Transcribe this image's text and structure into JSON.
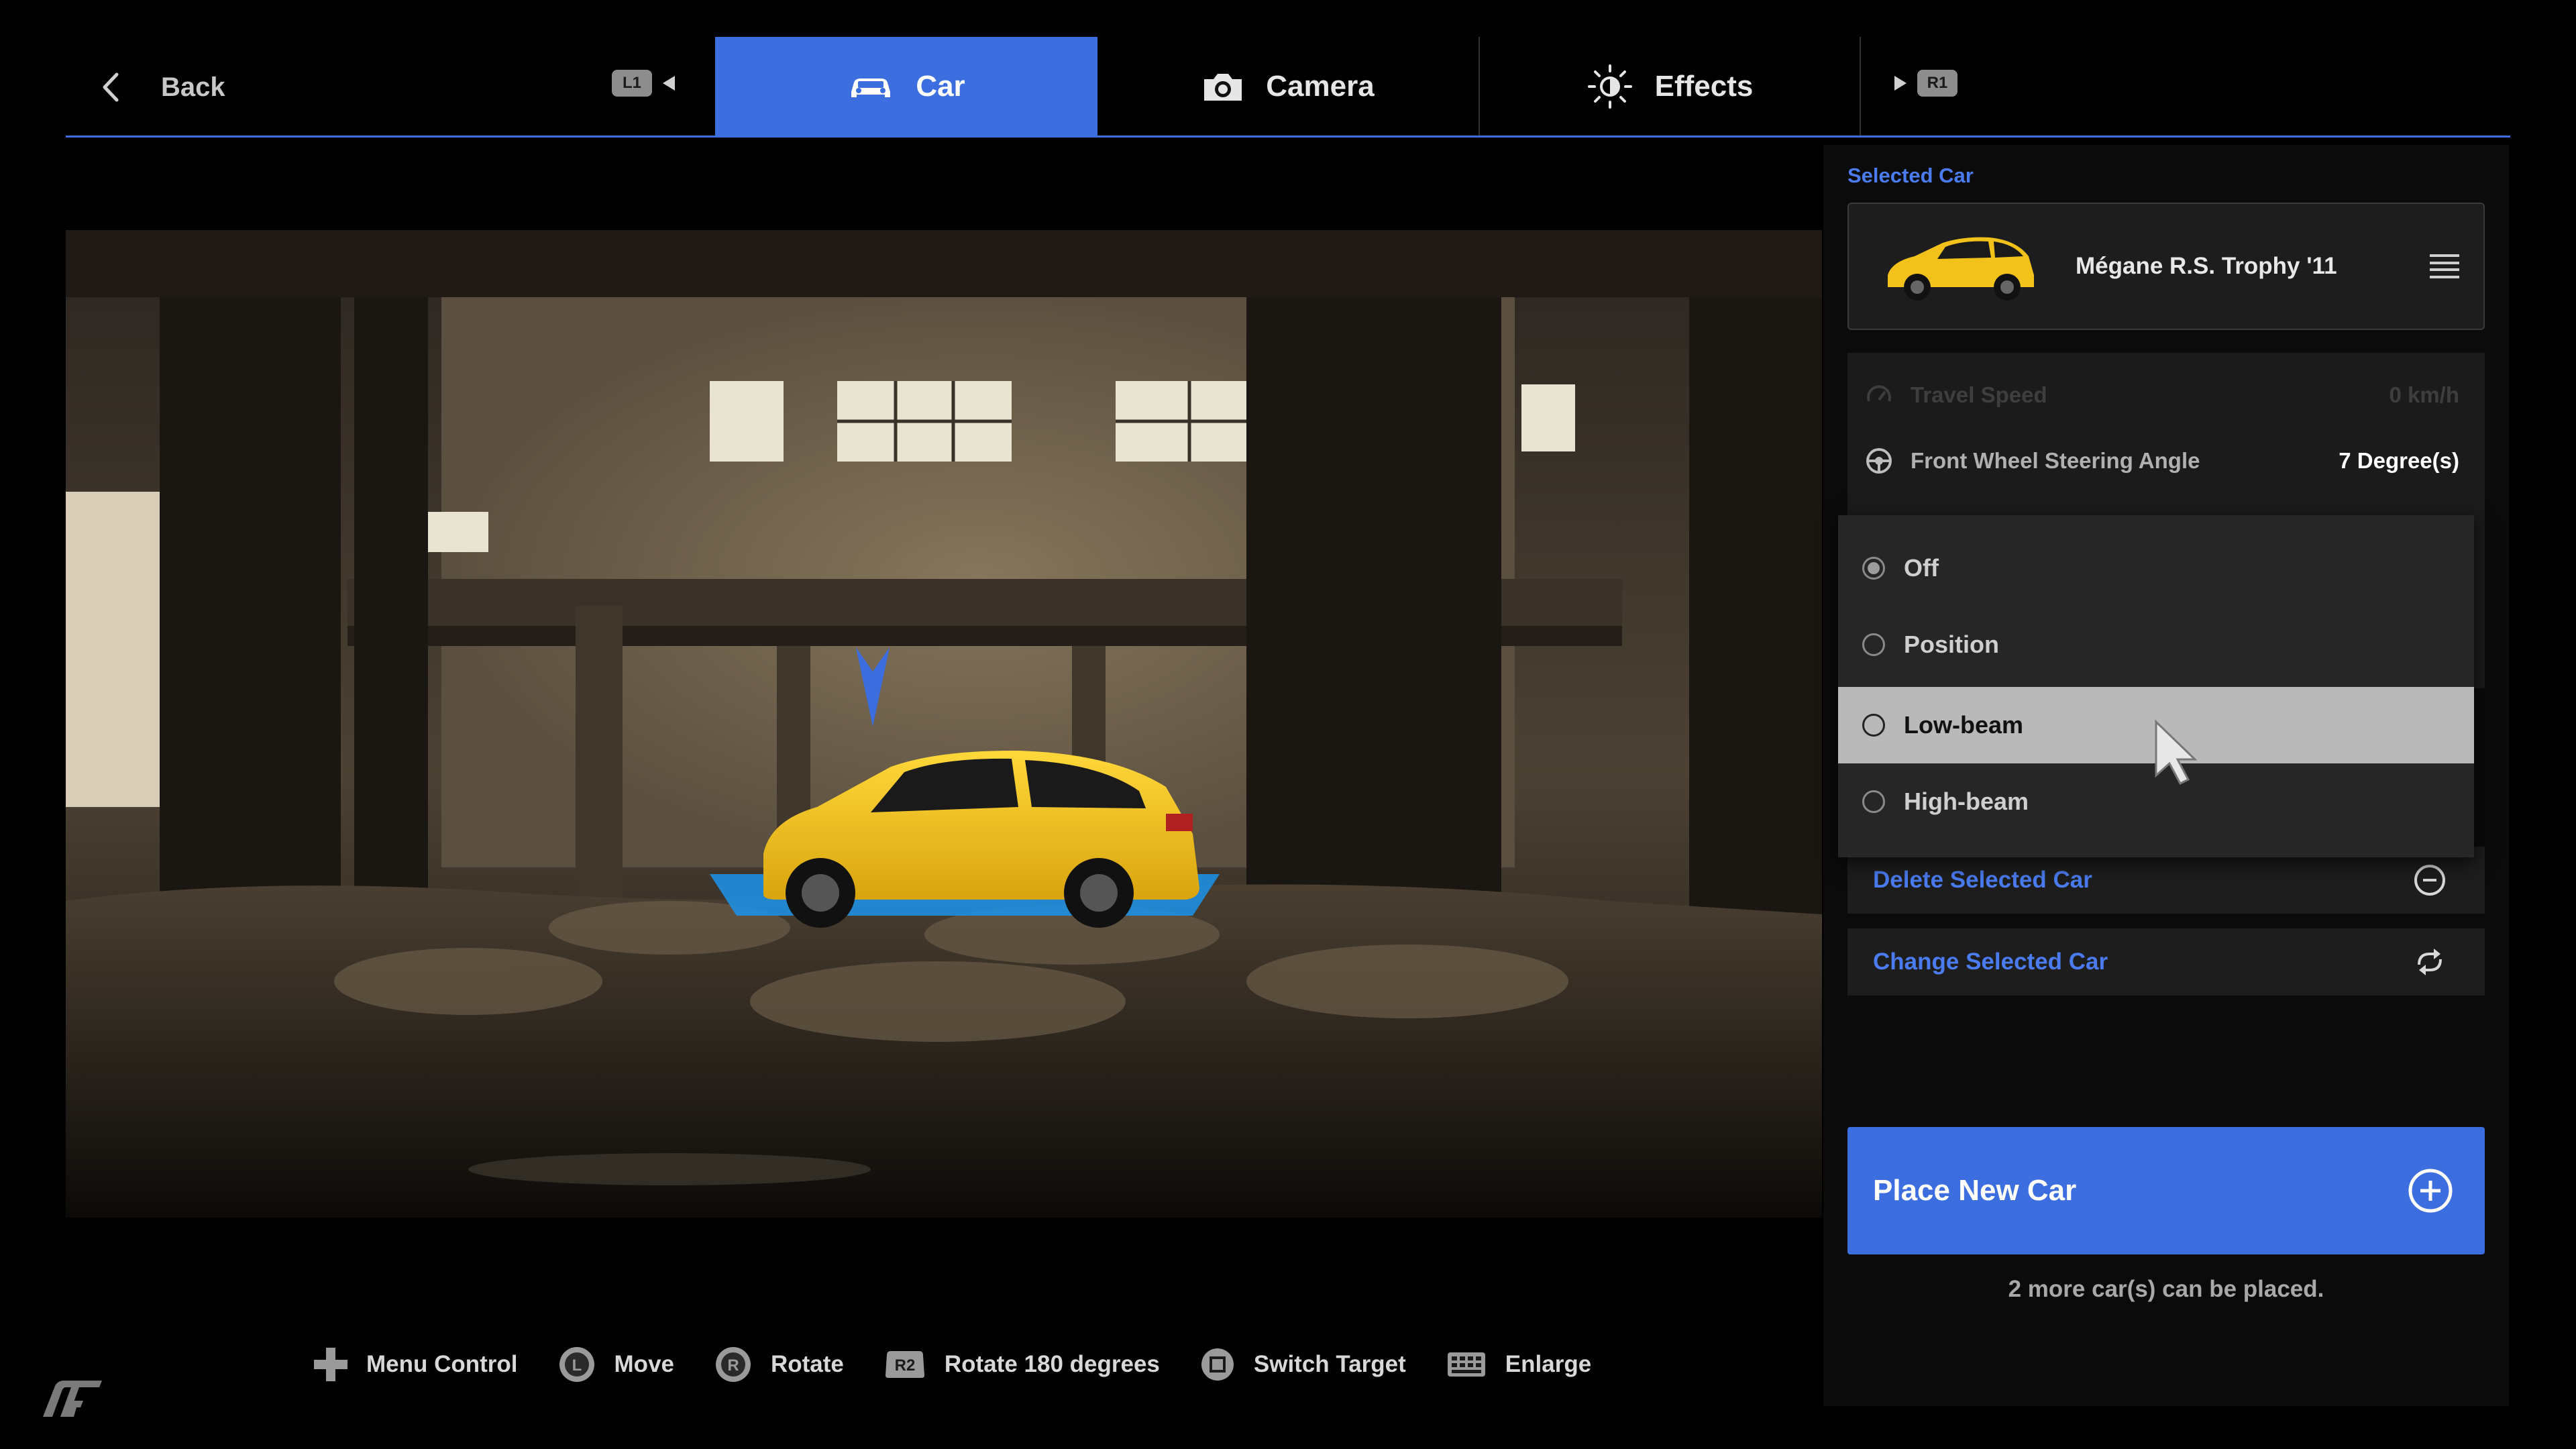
{
  "nav": {
    "back_label": "Back",
    "left_trigger": "L1",
    "right_trigger": "R1",
    "tabs": [
      {
        "label": "Car",
        "icon": "car-icon",
        "active": true
      },
      {
        "label": "Camera",
        "icon": "camera-icon",
        "active": false
      },
      {
        "label": "Effects",
        "icon": "brightness-icon",
        "active": false
      }
    ],
    "accent_color": "#3d6ee0"
  },
  "panel": {
    "selected_car_label": "Selected Car",
    "car_name": "Mégane R.S. Trophy '11",
    "settings": [
      {
        "label": "Travel Speed",
        "value": "0 km/h",
        "icon": "speedometer-icon",
        "disabled": true
      },
      {
        "label": "Front Wheel Steering Angle",
        "value": "7 Degree(s)",
        "icon": "steering-wheel-icon",
        "disabled": false
      }
    ],
    "lights_dropdown": {
      "options": [
        "Off",
        "Position",
        "Low-beam",
        "High-beam"
      ],
      "selected": "Off",
      "highlighted": "Low-beam"
    },
    "actions": [
      {
        "label": "Delete Selected Car",
        "icon": "minus-circle-icon"
      },
      {
        "label": "Change Selected Car",
        "icon": "swap-arrows-icon"
      }
    ],
    "place_button": {
      "label": "Place New Car",
      "icon": "plus-circle-icon"
    },
    "remaining_text": "2 more car(s) can be placed."
  },
  "controls": [
    {
      "label": "Menu Control",
      "icon": "dpad-icon"
    },
    {
      "label": "Move",
      "icon": "left-stick-icon",
      "glyph": "L"
    },
    {
      "label": "Rotate",
      "icon": "right-stick-icon",
      "glyph": "R"
    },
    {
      "label": "Rotate 180 degrees",
      "icon": "r2-button-icon",
      "glyph": "R2"
    },
    {
      "label": "Switch Target",
      "icon": "square-button-icon"
    },
    {
      "label": "Enlarge",
      "icon": "touchpad-icon"
    }
  ],
  "scene": {
    "car_color": "#f2c21a",
    "marker_color": "#3d6ee0",
    "shadow_color": "#1e8fe0"
  }
}
